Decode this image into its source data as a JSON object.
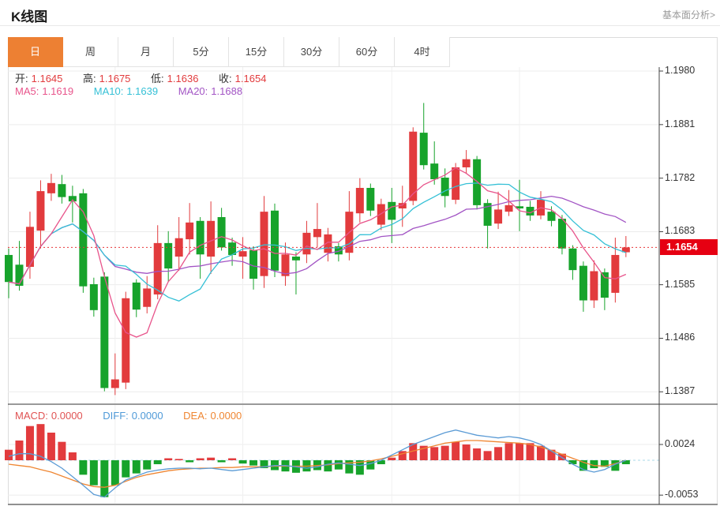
{
  "header": {
    "title": "K线图",
    "link": "基本面分析>"
  },
  "tabs": {
    "items": [
      "日",
      "周",
      "月",
      "5分",
      "15分",
      "30分",
      "60分",
      "4时"
    ],
    "active_index": 0
  },
  "legend": {
    "ohlc": [
      {
        "label": "开:",
        "value": "1.1645"
      },
      {
        "label": "高:",
        "value": "1.1675"
      },
      {
        "label": "低:",
        "value": "1.1636"
      },
      {
        "label": "收:",
        "value": "1.1654"
      }
    ],
    "ma": [
      {
        "label": "MA5:",
        "value": "1.1619",
        "color": "#e8548b"
      },
      {
        "label": "MA10:",
        "value": "1.1639",
        "color": "#35c0d6"
      },
      {
        "label": "MA20:",
        "value": "1.1688",
        "color": "#a254c4"
      }
    ]
  },
  "macd_legend": [
    {
      "label": "MACD:",
      "value": "0.0000",
      "color": "#e05353"
    },
    {
      "label": "DIFF:",
      "value": "0.0000",
      "color": "#4f9ad8"
    },
    {
      "label": "DEA:",
      "value": "0.0000",
      "color": "#ef8632"
    }
  ],
  "price_axis": {
    "current_label": "1.1654"
  },
  "colors": {
    "up": "#e23b3d",
    "down": "#17a32b",
    "ma5": "#e8548b",
    "ma10": "#35c0d6",
    "ma20": "#a254c4",
    "diff": "#5b9bd5",
    "dea": "#ef8632",
    "current_line": "#e83539",
    "badge": "#e60012",
    "grid": "#ececec",
    "axis": "#444",
    "zero_dash": "#a8d8ea",
    "tab_active": "#ed8033"
  },
  "chart_data": {
    "type": "candlestick",
    "title": "K线图",
    "x_count": 59,
    "x_grid_indices": [
      10,
      22,
      36,
      48
    ],
    "panels": [
      {
        "name": "price",
        "y_tick_labels": [
          "1.1980",
          "1.1881",
          "1.1782",
          "1.1683",
          "1.1585",
          "1.1486",
          "1.1387"
        ],
        "current_price": 1.1654,
        "ma_periods": [
          5,
          10,
          20
        ],
        "ohlc": [
          [
            1.164,
            1.1652,
            1.156,
            1.159
          ],
          [
            1.1622,
            1.1666,
            1.1574,
            1.1583
          ],
          [
            1.1618,
            1.172,
            1.1596,
            1.1692
          ],
          [
            1.1685,
            1.1778,
            1.1652,
            1.1758
          ],
          [
            1.1754,
            1.179,
            1.174,
            1.1773
          ],
          [
            1.1771,
            1.1788,
            1.1735,
            1.1747
          ],
          [
            1.1749,
            1.1768,
            1.17,
            1.1739
          ],
          [
            1.1754,
            1.1762,
            1.157,
            1.1582
          ],
          [
            1.1586,
            1.1598,
            1.1526,
            1.1538
          ],
          [
            1.16,
            1.1608,
            1.1388,
            1.1394
          ],
          [
            1.1394,
            1.1458,
            1.1381,
            1.141
          ],
          [
            1.1404,
            1.1572,
            1.1392,
            1.156
          ],
          [
            1.1589,
            1.1595,
            1.1525,
            1.1539
          ],
          [
            1.1544,
            1.1601,
            1.1532,
            1.1578
          ],
          [
            1.1567,
            1.1695,
            1.1558,
            1.1662
          ],
          [
            1.1662,
            1.1684,
            1.159,
            1.1615
          ],
          [
            1.1637,
            1.171,
            1.1611,
            1.1671
          ],
          [
            1.1669,
            1.1736,
            1.1641,
            1.17
          ],
          [
            1.1703,
            1.171,
            1.1596,
            1.1641
          ],
          [
            1.1637,
            1.1739,
            1.1605,
            1.1703
          ],
          [
            1.171,
            1.1727,
            1.1648,
            1.1654
          ],
          [
            1.1663,
            1.1672,
            1.162,
            1.164
          ],
          [
            1.1637,
            1.1673,
            1.1596,
            1.1647
          ],
          [
            1.1649,
            1.1656,
            1.1576,
            1.1596
          ],
          [
            1.1601,
            1.1749,
            1.1579,
            1.172
          ],
          [
            1.1722,
            1.1735,
            1.1599,
            1.1611
          ],
          [
            1.1601,
            1.1663,
            1.1583,
            1.1641
          ],
          [
            1.1637,
            1.1645,
            1.1567,
            1.163
          ],
          [
            1.1641,
            1.1703,
            1.1625,
            1.1681
          ],
          [
            1.1673,
            1.1736,
            1.1654,
            1.1688
          ],
          [
            1.1644,
            1.169,
            1.1628,
            1.1678
          ],
          [
            1.1656,
            1.1662,
            1.1628,
            1.1641
          ],
          [
            1.1644,
            1.1758,
            1.163,
            1.172
          ],
          [
            1.1717,
            1.1782,
            1.17,
            1.1764
          ],
          [
            1.1764,
            1.1772,
            1.1712,
            1.1722
          ],
          [
            1.1696,
            1.1744,
            1.1686,
            1.1734
          ],
          [
            1.1738,
            1.1764,
            1.1662,
            1.1705
          ],
          [
            1.1726,
            1.1768,
            1.1692,
            1.1736
          ],
          [
            1.174,
            1.1876,
            1.1732,
            1.1868
          ],
          [
            1.1866,
            1.1921,
            1.1798,
            1.1806
          ],
          [
            1.1809,
            1.185,
            1.177,
            1.178
          ],
          [
            1.1783,
            1.18,
            1.1728,
            1.1749
          ],
          [
            1.1742,
            1.181,
            1.1734,
            1.1802
          ],
          [
            1.1802,
            1.1834,
            1.179,
            1.1817
          ],
          [
            1.1817,
            1.1823,
            1.1724,
            1.1732
          ],
          [
            1.1736,
            1.1743,
            1.1652,
            1.1694
          ],
          [
            1.1698,
            1.1757,
            1.1688,
            1.1724
          ],
          [
            1.172,
            1.176,
            1.1712,
            1.1732
          ],
          [
            1.173,
            1.1779,
            1.1684,
            1.1726
          ],
          [
            1.1729,
            1.174,
            1.1703,
            1.1713
          ],
          [
            1.1713,
            1.1758,
            1.1706,
            1.1742
          ],
          [
            1.172,
            1.173,
            1.1693,
            1.1703
          ],
          [
            1.1707,
            1.1714,
            1.1641,
            1.1652
          ],
          [
            1.1652,
            1.1658,
            1.1594,
            1.1612
          ],
          [
            1.162,
            1.1628,
            1.1535,
            1.1556
          ],
          [
            1.1556,
            1.163,
            1.1542,
            1.161
          ],
          [
            1.1608,
            1.1615,
            1.1538,
            1.1561
          ],
          [
            1.157,
            1.1672,
            1.1552,
            1.164
          ],
          [
            1.1645,
            1.1675,
            1.1636,
            1.1654
          ]
        ]
      },
      {
        "name": "macd",
        "y_tick_labels": [
          "0.0024",
          "-0.0053"
        ],
        "macd": [
          0.0016,
          0.003,
          0.0052,
          0.0055,
          0.0042,
          0.0028,
          0.0012,
          -0.0022,
          -0.0038,
          -0.0056,
          -0.0038,
          -0.0026,
          -0.002,
          -0.0014,
          -0.0006,
          0.0003,
          0.0002,
          -0.0003,
          0.0003,
          0.0004,
          -0.0003,
          0.0003,
          -0.0005,
          -0.0008,
          -0.0012,
          -0.0015,
          -0.0017,
          -0.0019,
          -0.0017,
          -0.0015,
          -0.0017,
          -0.0014,
          -0.002,
          -0.0022,
          -0.0014,
          -0.0006,
          0.0004,
          0.0014,
          0.0026,
          0.0022,
          0.002,
          0.0022,
          0.0028,
          0.0024,
          0.0018,
          0.0014,
          0.002,
          0.0026,
          0.0026,
          0.0026,
          0.0022,
          0.0016,
          0.001,
          -0.0006,
          -0.0016,
          -0.0012,
          -0.001,
          -0.0016,
          -0.0006
        ],
        "diff": [
          0.0006,
          0.001,
          0.001,
          0.0006,
          -0.0002,
          -0.0012,
          -0.0025,
          -0.0038,
          -0.0052,
          -0.0056,
          -0.0042,
          -0.003,
          -0.0024,
          -0.0018,
          -0.0015,
          -0.0013,
          -0.0012,
          -0.0012,
          -0.0013,
          -0.0012,
          -0.0014,
          -0.0016,
          -0.0014,
          -0.0012,
          -0.001,
          -0.0008,
          -0.0008,
          -0.001,
          -0.0012,
          -0.001,
          -0.0006,
          -0.0004,
          -0.0006,
          -0.0008,
          -0.0005,
          0.0,
          0.0008,
          0.0016,
          0.0024,
          0.003,
          0.0036,
          0.0042,
          0.0046,
          0.0042,
          0.0038,
          0.0036,
          0.0034,
          0.0036,
          0.0034,
          0.003,
          0.0024,
          0.0014,
          0.0004,
          -0.0006,
          -0.0014,
          -0.0018,
          -0.0014,
          -0.0006,
          0.0
        ],
        "dea": [
          -0.0006,
          -0.0008,
          -0.001,
          -0.0014,
          -0.0018,
          -0.0024,
          -0.003,
          -0.0036,
          -0.004,
          -0.0041,
          -0.0038,
          -0.0032,
          -0.0026,
          -0.0022,
          -0.0019,
          -0.0016,
          -0.0014,
          -0.0013,
          -0.0012,
          -0.0012,
          -0.0011,
          -0.0011,
          -0.001,
          -0.001,
          -0.001,
          -0.0009,
          -0.0009,
          -0.0009,
          -0.0009,
          -0.0008,
          -0.0007,
          -0.0005,
          -0.0004,
          -0.0003,
          -0.0001,
          0.0002,
          0.0006,
          0.001,
          0.0014,
          0.0018,
          0.0022,
          0.0026,
          0.0028,
          0.003,
          0.003,
          0.0029,
          0.0028,
          0.0027,
          0.0026,
          0.0024,
          0.002,
          0.0015,
          0.0009,
          0.0003,
          -0.0003,
          -0.0008,
          -0.0009,
          -0.0005,
          0.0
        ]
      }
    ]
  }
}
